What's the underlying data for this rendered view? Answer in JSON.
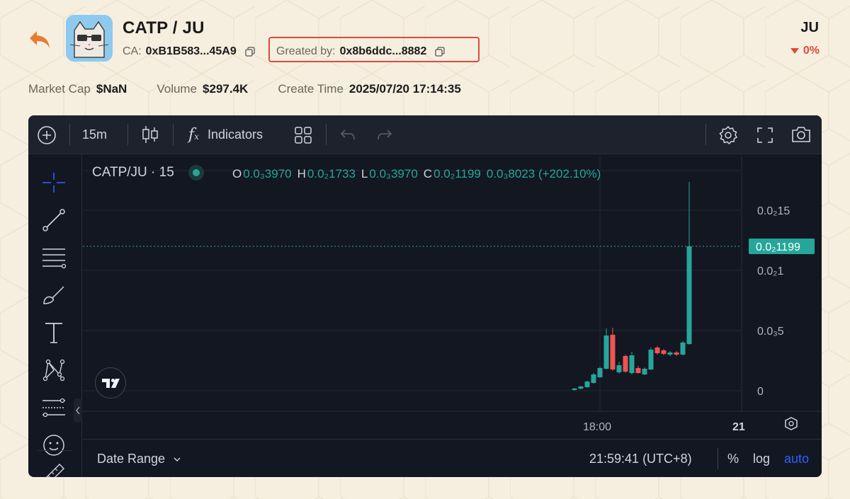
{
  "header": {
    "pair_title": "CATP / JU",
    "ca_label": "CA:",
    "ca_value": "0xB1B583...45A9",
    "created_label": "Greated by:",
    "created_value": "0x8b6ddc...8882",
    "ticker": "JU",
    "change": "0%",
    "accent": "#e0493a"
  },
  "stats": {
    "market_cap_label": "Market Cap",
    "market_cap_value": "$NaN",
    "volume_label": "Volume",
    "volume_value": "$297.4K",
    "create_time_label": "Create Time",
    "create_time_value": "2025/07/20 17:14:35"
  },
  "toolbar": {
    "interval": "15m",
    "indicators_label": "Indicators"
  },
  "legend": {
    "symbol": "CATP/JU · 15",
    "o_label": "O",
    "o_value": "0.0₃3970",
    "h_label": "H",
    "h_value": "0.0₂1733",
    "l_label": "L",
    "l_value": "0.0₃3970",
    "c_label": "C",
    "c_value": "0.0₂1199",
    "change_value": "0.0₃8023 (+202.10%)"
  },
  "axis": {
    "y_ticks": [
      "0.0₂15",
      "0.0₂1",
      "0.0₃5",
      "0"
    ],
    "price_tag": "0.0₂1199",
    "x_ticks": [
      "18:00",
      "21"
    ]
  },
  "bottom": {
    "date_range": "Date Range",
    "time": "21:59:41 (UTC+8)",
    "percent": "%",
    "log": "log",
    "auto": "auto"
  },
  "colors": {
    "up": "#26a69a",
    "down": "#ef5350",
    "panel_bg": "#131722",
    "toolbar_bg": "#1e222d",
    "auto_blue": "#2962ff"
  }
}
